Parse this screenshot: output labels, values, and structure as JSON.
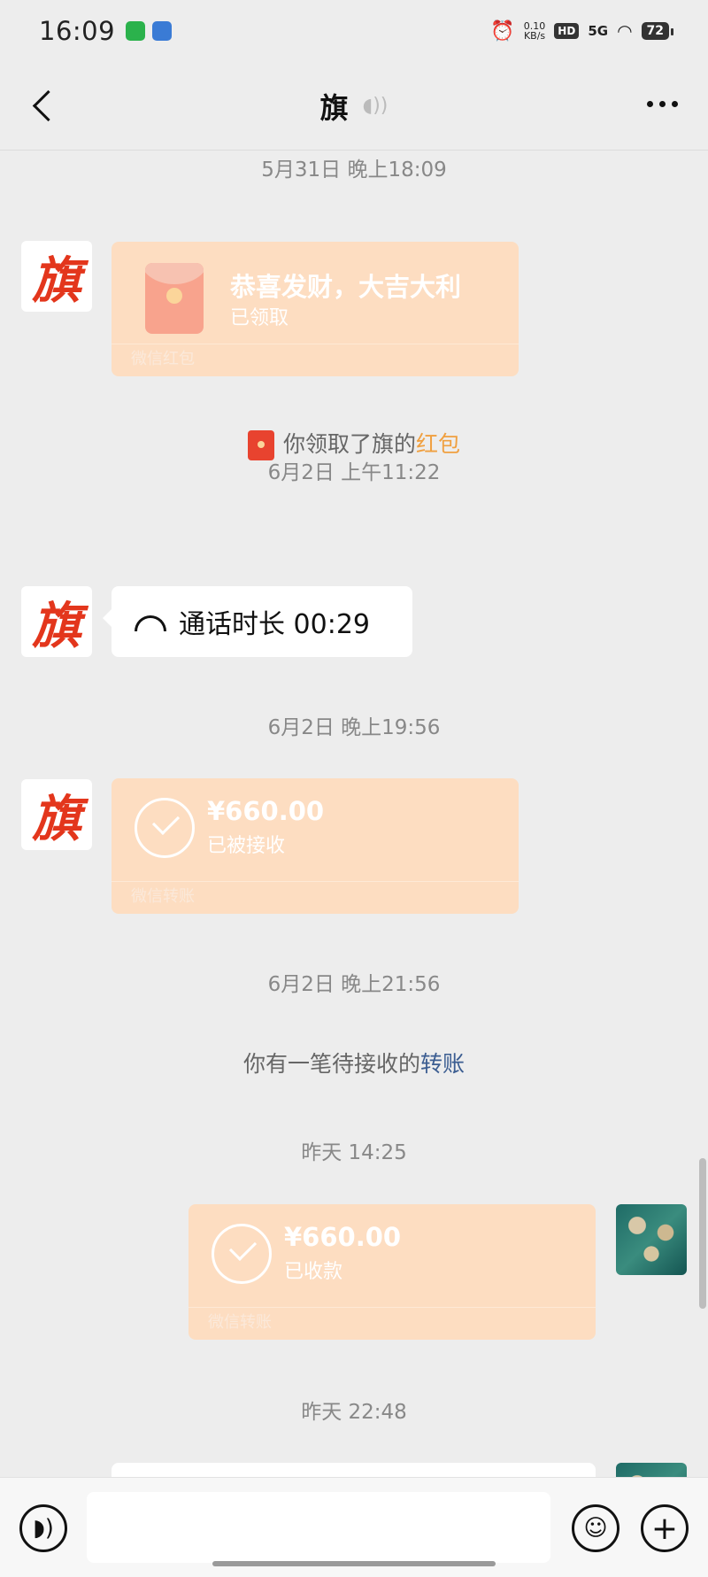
{
  "status_bar": {
    "time": "16:09",
    "net_speed_value": "0.10",
    "net_speed_unit": "KB/s",
    "hd": "HD",
    "signal": "5G",
    "battery": "72"
  },
  "header": {
    "title": "旗"
  },
  "messages": {
    "t1": "5月31日 晚上18:09",
    "red_packet": {
      "wish": "恭喜发财，大吉大利",
      "status": "已领取",
      "footer": "微信红包"
    },
    "sys_red_packet": {
      "prefix": "你领取了旗的",
      "link": "红包"
    },
    "t2": "6月2日 上午11:22",
    "call": {
      "text": "通话时长 00:29"
    },
    "t3": "6月2日 晚上19:56",
    "transfer_in": {
      "amount": "¥660.00",
      "status": "已被接收",
      "footer": "微信转账"
    },
    "t4": "6月2日 晚上21:56",
    "sys_transfer": {
      "prefix": "你有一笔待接收的",
      "link": "转账"
    },
    "t5": "昨天 14:25",
    "transfer_out": {
      "amount": "¥660.00",
      "status": "已收款",
      "footer": "微信转账"
    },
    "t6": "昨天 22:48"
  },
  "avatars": {
    "contact_char": "旗"
  },
  "colors": {
    "card": "#fdddc1",
    "background": "#ededed",
    "link_orange": "#f0a040",
    "link_blue": "#3b5d91"
  }
}
